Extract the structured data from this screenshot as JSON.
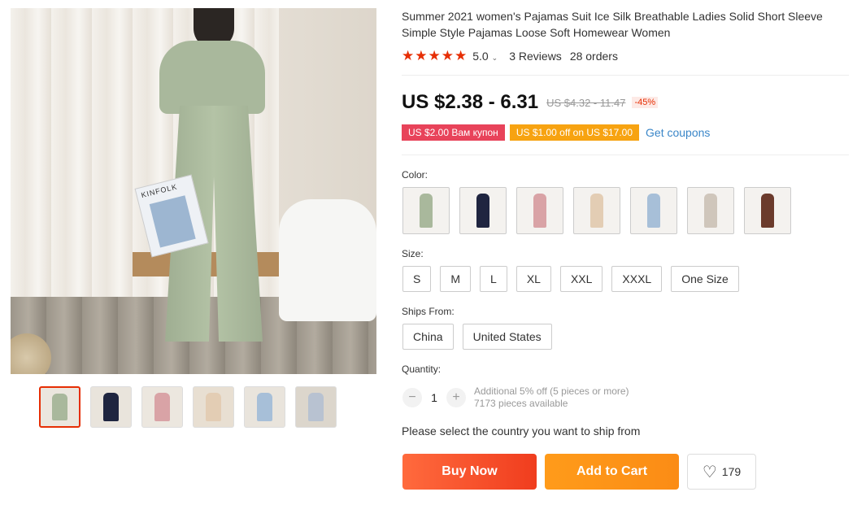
{
  "product": {
    "title": "Summer 2021 women's Pajamas Suit Ice Silk Breathable Ladies Solid Short Sleeve Simple Style Pajamas Loose Soft Homewear Women",
    "rating": {
      "stars": "★★★★★",
      "value": "5.0",
      "reviews": "3 Reviews",
      "orders": "28 orders"
    },
    "price": {
      "current": "US $2.38 - 6.31",
      "original": "US $4.32 - 11.47",
      "discount": "-45%"
    },
    "coupons": {
      "coupon1": "US $2.00 Вам купон",
      "coupon2": "US $1.00 off on US $17.00",
      "get": "Get coupons"
    },
    "magazine_text": "KINFOLK"
  },
  "options": {
    "color_label": "Color:",
    "colors": [
      "#a9b89c",
      "#1f2540",
      "#d9a3a6",
      "#e3cdb4",
      "#a7bfd8",
      "#cfc6bb",
      "#6b3b2c"
    ],
    "size_label": "Size:",
    "sizes": [
      "S",
      "M",
      "L",
      "XL",
      "XXL",
      "XXXL",
      "One Size"
    ],
    "ships_label": "Ships From:",
    "ships": [
      "China",
      "United States"
    ],
    "quantity_label": "Quantity:",
    "quantity_value": "1",
    "quantity_minus": "−",
    "quantity_plus": "+",
    "quantity_info": "Additional 5% off (5 pieces or more)",
    "available": "7173 pieces available"
  },
  "shipping_message": "Please select the country you want to ship from",
  "actions": {
    "buy": "Buy Now",
    "cart": "Add to Cart",
    "wishlist_count": "179"
  },
  "thumbnails": [
    "#a9b89c",
    "#1f2540",
    "#d9a3a6",
    "#e3cdb4",
    "#a7bfd8",
    "#b8c2d1"
  ]
}
